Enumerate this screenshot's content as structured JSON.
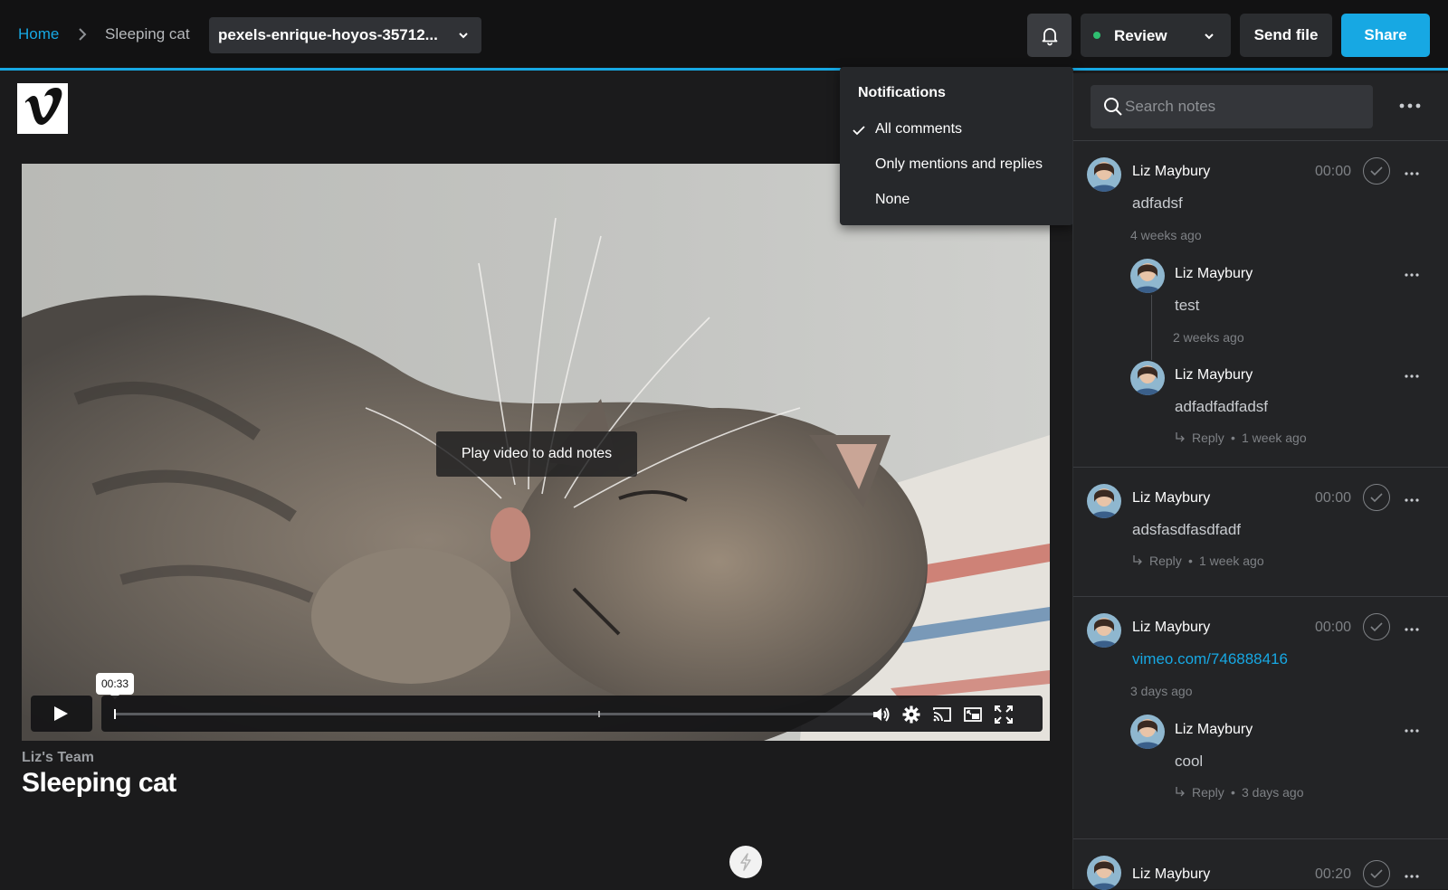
{
  "breadcrumb": {
    "home": "Home",
    "current": "Sleeping cat"
  },
  "file_select": {
    "label": "pexels-enrique-hoyos-35712..."
  },
  "toolbar": {
    "review_label": "Review",
    "send_label": "Send file",
    "share_label": "Share",
    "accent": "#17a8e3",
    "review_status_color": "#2fbf71"
  },
  "notifications": {
    "title": "Notifications",
    "options": [
      "All comments",
      "Only mentions and replies",
      "None"
    ],
    "selected": "All comments"
  },
  "player": {
    "hint": "Play video to add notes",
    "time_tooltip": "00:33",
    "progress_fraction": 0.0,
    "icons": [
      "play-icon",
      "volume-icon",
      "settings-gear-icon",
      "cast-icon",
      "picture-in-picture-icon",
      "fullscreen-icon"
    ]
  },
  "video": {
    "team": "Liz's Team",
    "title": "Sleeping cat"
  },
  "search": {
    "placeholder": "Search notes"
  },
  "notes": [
    {
      "author": "Liz Maybury",
      "time": "00:00",
      "text": "adfadsf",
      "meta": "4 weeks ago",
      "replies": [
        {
          "author": "Liz Maybury",
          "text": "test",
          "meta": "2 weeks ago"
        },
        {
          "author": "Liz Maybury",
          "text": "adfadfadfadsf",
          "reply_label": "Reply",
          "meta": "1 week ago"
        }
      ]
    },
    {
      "author": "Liz Maybury",
      "time": "00:00",
      "text": "adsfasdfasdfadf",
      "reply_label": "Reply",
      "meta": "1 week ago"
    },
    {
      "author": "Liz Maybury",
      "time": "00:00",
      "link": "vimeo.com/746888416",
      "meta": "3 days ago",
      "replies": [
        {
          "author": "Liz Maybury",
          "text": "cool",
          "reply_label": "Reply",
          "meta": "3 days ago"
        }
      ]
    },
    {
      "author": "Liz Maybury",
      "time": "00:20"
    }
  ]
}
